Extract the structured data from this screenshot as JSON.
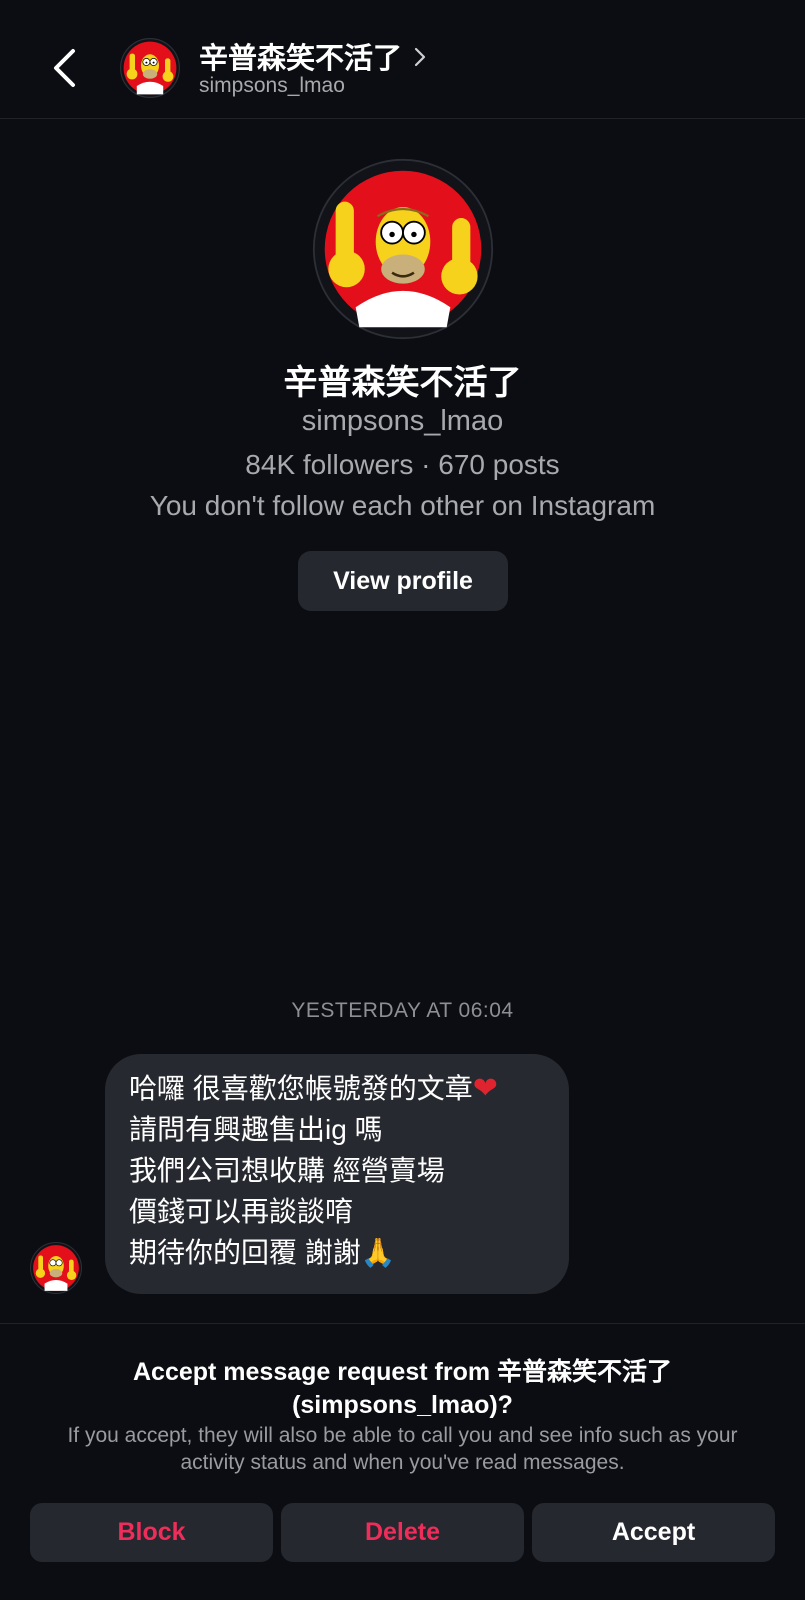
{
  "header": {
    "title": "辛普森笑不活了",
    "username": "simpsons_lmao"
  },
  "profile": {
    "name": "辛普森笑不活了",
    "handle": "simpsons_lmao",
    "stats": "84K followers · 670 posts",
    "follow_note": "You don't follow each other on Instagram",
    "view_profile_label": "View profile"
  },
  "conversation": {
    "timestamp": "YESTERDAY AT 06:04",
    "message_lines": [
      "哈囉 很喜歡您帳號發的文章",
      "請問有興趣售出ig 嗎",
      "我們公司想收購 經營賣場",
      "價錢可以再談談唷",
      "期待你的回覆 謝謝"
    ],
    "emoji": {
      "heart": "❤",
      "pray": "🙏"
    }
  },
  "request": {
    "title_line1": "Accept message request from 辛普森笑不活了",
    "title_line2": "(simpsons_lmao)?",
    "description": "If you accept, they will also be able to call you and see info such as your activity status and when you've read messages.",
    "block_label": "Block",
    "delete_label": "Delete",
    "accept_label": "Accept"
  },
  "colors": {
    "background": "#0b0d12",
    "surface": "#25282e",
    "bubble": "#26292f",
    "danger": "#ee2d5a",
    "secondary_text": "#a8a9ad"
  }
}
